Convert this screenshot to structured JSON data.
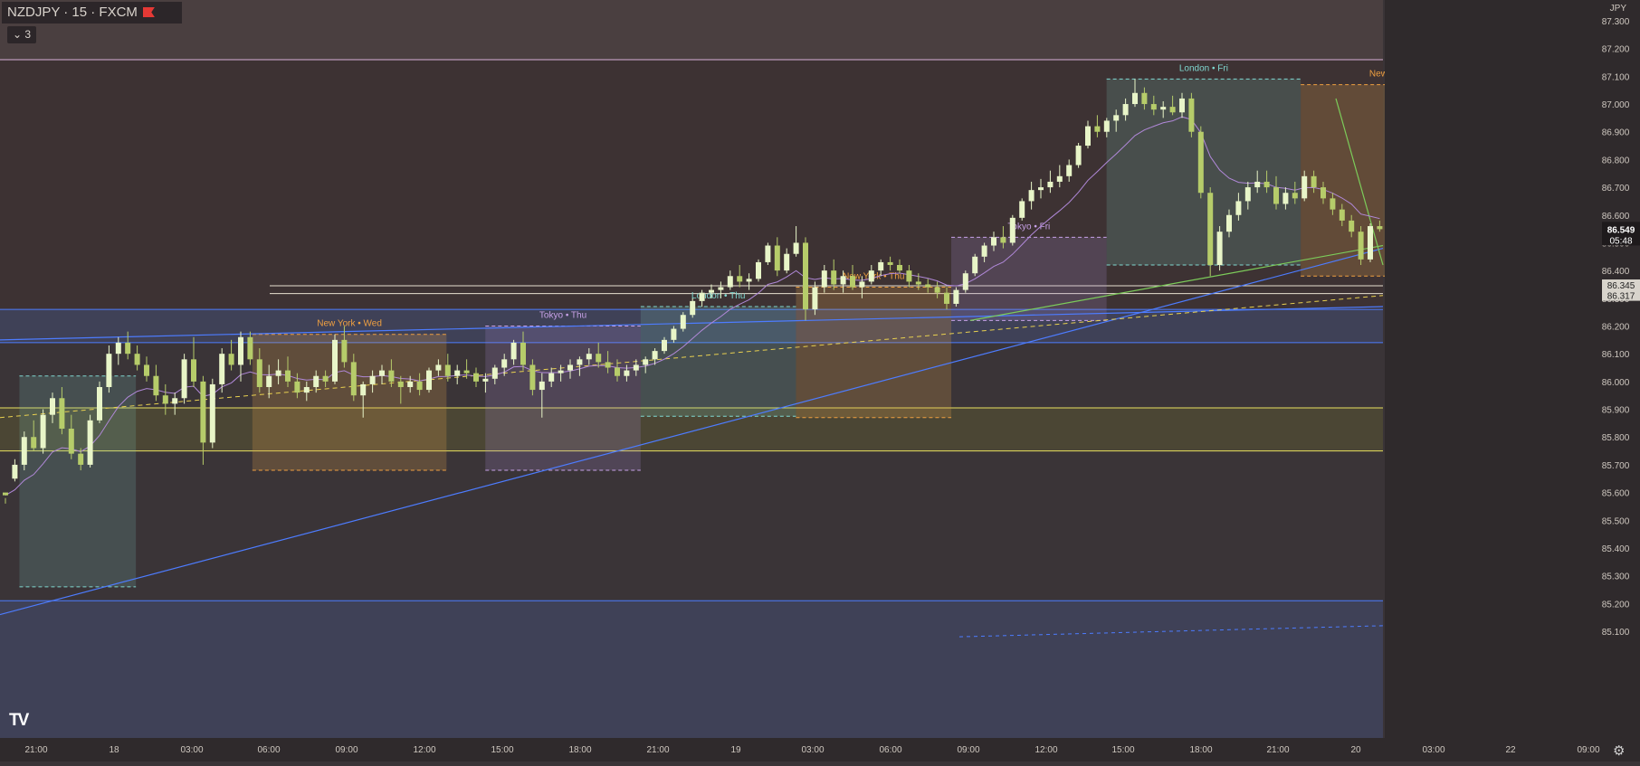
{
  "header": {
    "symbol_title": "NZDJPY · 15 · FXCM",
    "indicator_count": "3",
    "currency": "JPY"
  },
  "colors": {
    "background": "#3a3437",
    "upper_zone": "#4a3f40",
    "middle_zone": "#3d3233",
    "bull": "#e8f5c8",
    "bear": "#b6cc6a",
    "tokyo": "#c8a2e8",
    "london": "#7fd8d0",
    "newyork": "#f0a040",
    "trendline_blue": "#4d7cff",
    "trendline_green": "#7ccc5a",
    "ma_line": "#b088d8",
    "yellow_dashed": "#e8d050"
  },
  "chart_data": {
    "type": "candlestick",
    "symbol": "NZDJPY",
    "interval": "15",
    "source": "FXCM",
    "ylim": [
      85.06,
      87.34
    ],
    "y_ticks": [
      "87.300",
      "87.200",
      "87.100",
      "87.000",
      "86.900",
      "86.800",
      "86.700",
      "86.600",
      "86.500",
      "86.400",
      "86.300",
      "86.200",
      "86.100",
      "86.000",
      "85.900",
      "85.800",
      "85.700",
      "85.600",
      "85.500",
      "85.400",
      "85.300",
      "85.200",
      "85.100"
    ],
    "x_ticks": [
      "21:00",
      "18",
      "03:00",
      "06:00",
      "09:00",
      "12:00",
      "15:00",
      "18:00",
      "21:00",
      "19",
      "03:00",
      "06:00",
      "09:00",
      "12:00",
      "15:00",
      "18:00",
      "21:00",
      "20",
      "03:00",
      "22",
      "09:00"
    ],
    "last_price": "86.549",
    "countdown": "05:48",
    "price_labels": [
      "86.345",
      "86.317"
    ],
    "sessions": [
      {
        "label": "New York • Wed",
        "kind": "newyork",
        "start": 6.5,
        "end": 11.5,
        "high": 86.17,
        "low": 85.68
      },
      {
        "label": "Tokyo • Thu",
        "kind": "tokyo",
        "start": 12.5,
        "end": 16.5,
        "high": 86.2,
        "low": 85.68
      },
      {
        "label": "London • Thu",
        "kind": "london",
        "start": 16.5,
        "end": 20.5,
        "high": 86.27,
        "low": 85.875
      },
      {
        "label": "New York • Thu",
        "kind": "newyork",
        "start": 20.5,
        "end": 24.5,
        "high": 86.34,
        "low": 85.87
      },
      {
        "label": "Tokyo • Fri",
        "kind": "tokyo",
        "start": 24.5,
        "end": 28.5,
        "high": 86.52,
        "low": 86.22
      },
      {
        "label": "London • Fri",
        "kind": "london",
        "start": 28.5,
        "end": 33.5,
        "high": 87.09,
        "low": 86.42
      },
      {
        "label": "New York • Fri",
        "kind": "newyork",
        "start": 33.5,
        "end": 38.5,
        "high": 87.07,
        "low": 86.38
      },
      {
        "label": "",
        "kind": "london",
        "start": 0.5,
        "end": 3.5,
        "high": 86.02,
        "low": 85.26
      }
    ],
    "horizontal_lines": [
      86.345,
      86.317,
      85.905,
      85.75
    ],
    "zones": [
      {
        "top": 87.16,
        "bottom": 87.34
      },
      {
        "top": 86.26,
        "bottom": 86.14
      },
      {
        "top": 85.905,
        "bottom": 85.75
      },
      {
        "top": 85.21,
        "bottom": 85.06
      }
    ],
    "candles": [
      [
        0,
        85.6,
        85.56,
        85.58,
        85.59
      ],
      [
        1,
        85.65,
        85.72,
        85.64,
        85.7
      ],
      [
        2,
        85.7,
        85.82,
        85.68,
        85.8
      ],
      [
        3,
        85.8,
        85.86,
        85.75,
        85.76
      ],
      [
        4,
        85.76,
        85.9,
        85.74,
        85.88
      ],
      [
        5,
        85.88,
        85.96,
        85.85,
        85.94
      ],
      [
        6,
        85.94,
        85.98,
        85.81,
        85.83
      ],
      [
        7,
        85.83,
        85.88,
        85.72,
        85.74
      ],
      [
        8,
        85.74,
        85.76,
        85.68,
        85.7
      ],
      [
        9,
        85.7,
        85.88,
        85.69,
        85.86
      ],
      [
        10,
        85.86,
        86.0,
        85.85,
        85.98
      ],
      [
        11,
        85.98,
        86.13,
        85.96,
        86.1
      ],
      [
        12,
        86.1,
        86.16,
        86.06,
        86.14
      ],
      [
        13,
        86.14,
        86.18,
        86.08,
        86.1
      ],
      [
        14,
        86.1,
        86.13,
        86.04,
        86.06
      ],
      [
        15,
        86.06,
        86.09,
        86.0,
        86.02
      ],
      [
        16,
        86.02,
        86.06,
        85.93,
        85.95
      ],
      [
        17,
        85.95,
        85.99,
        85.88,
        85.92
      ],
      [
        18,
        85.92,
        85.96,
        85.88,
        85.94
      ],
      [
        19,
        85.94,
        86.1,
        85.92,
        86.08
      ],
      [
        20,
        86.08,
        86.16,
        85.98,
        86.0
      ],
      [
        21,
        86.0,
        86.02,
        85.7,
        85.78
      ],
      [
        22,
        85.78,
        86.01,
        85.76,
        85.99
      ],
      [
        23,
        85.99,
        86.12,
        85.96,
        86.1
      ],
      [
        24,
        86.1,
        86.15,
        86.04,
        86.06
      ],
      [
        25,
        86.06,
        86.18,
        86.0,
        86.16
      ],
      [
        26,
        86.16,
        86.18,
        86.06,
        86.08
      ],
      [
        27,
        86.08,
        86.12,
        85.96,
        85.98
      ],
      [
        28,
        85.98,
        86.06,
        85.94,
        86.02
      ],
      [
        29,
        86.02,
        86.08,
        85.99,
        86.04
      ],
      [
        30,
        86.04,
        86.09,
        85.98,
        86.0
      ],
      [
        31,
        86.0,
        86.03,
        85.94,
        85.96
      ],
      [
        32,
        85.96,
        86.0,
        85.93,
        85.98
      ],
      [
        33,
        85.98,
        86.04,
        85.96,
        86.02
      ],
      [
        34,
        86.02,
        86.04,
        85.98,
        86.0
      ],
      [
        35,
        86.0,
        86.17,
        85.99,
        86.15
      ],
      [
        36,
        86.15,
        86.2,
        86.05,
        86.07
      ],
      [
        37,
        86.07,
        86.1,
        85.93,
        85.95
      ],
      [
        38,
        85.95,
        86.0,
        85.87,
        85.99
      ],
      [
        39,
        85.99,
        86.04,
        85.96,
        86.02
      ],
      [
        40,
        86.02,
        86.06,
        85.99,
        86.04
      ],
      [
        41,
        86.04,
        86.08,
        85.98,
        86.0
      ],
      [
        42,
        86.0,
        86.02,
        85.92,
        85.98
      ],
      [
        43,
        85.98,
        86.02,
        85.96,
        86.0
      ],
      [
        44,
        86.0,
        86.03,
        85.95,
        85.97
      ],
      [
        45,
        85.97,
        86.05,
        85.96,
        86.04
      ],
      [
        46,
        86.04,
        86.08,
        86.02,
        86.06
      ],
      [
        47,
        86.06,
        86.1,
        86.0,
        86.02
      ],
      [
        48,
        86.02,
        86.06,
        85.99,
        86.04
      ],
      [
        49,
        86.04,
        86.08,
        86.01,
        86.03
      ],
      [
        50,
        86.03,
        86.05,
        85.98,
        86.0
      ],
      [
        51,
        86.0,
        86.03,
        85.96,
        86.01
      ],
      [
        52,
        86.01,
        86.06,
        85.99,
        86.05
      ],
      [
        53,
        86.05,
        86.1,
        86.02,
        86.08
      ],
      [
        54,
        86.08,
        86.15,
        86.06,
        86.14
      ],
      [
        55,
        86.14,
        86.18,
        86.04,
        86.06
      ],
      [
        56,
        86.06,
        86.08,
        85.95,
        85.97
      ],
      [
        57,
        85.97,
        86.03,
        85.87,
        86.0
      ],
      [
        58,
        86.0,
        86.05,
        85.98,
        86.03
      ],
      [
        59,
        86.03,
        86.06,
        86.0,
        86.04
      ],
      [
        60,
        86.04,
        86.08,
        86.01,
        86.06
      ],
      [
        61,
        86.06,
        86.09,
        86.02,
        86.08
      ],
      [
        62,
        86.08,
        86.12,
        86.06,
        86.1
      ],
      [
        63,
        86.1,
        86.14,
        86.05,
        86.07
      ],
      [
        64,
        86.07,
        86.11,
        86.03,
        86.05
      ],
      [
        65,
        86.05,
        86.08,
        86.0,
        86.02
      ],
      [
        66,
        86.02,
        86.06,
        86.0,
        86.04
      ],
      [
        67,
        86.04,
        86.08,
        86.02,
        86.06
      ],
      [
        68,
        86.06,
        86.09,
        86.03,
        86.08
      ],
      [
        69,
        86.08,
        86.12,
        86.06,
        86.11
      ],
      [
        70,
        86.11,
        86.16,
        86.1,
        86.15
      ],
      [
        71,
        86.15,
        86.2,
        86.14,
        86.19
      ],
      [
        72,
        86.19,
        86.25,
        86.18,
        86.24
      ],
      [
        73,
        86.24,
        86.3,
        86.23,
        86.29
      ],
      [
        74,
        86.29,
        86.33,
        86.27,
        86.32
      ],
      [
        75,
        86.32,
        86.35,
        86.3,
        86.33
      ],
      [
        76,
        86.33,
        86.36,
        86.3,
        86.34
      ],
      [
        77,
        86.34,
        86.4,
        86.33,
        86.38
      ],
      [
        78,
        86.38,
        86.42,
        86.34,
        86.36
      ],
      [
        79,
        86.36,
        86.39,
        86.33,
        86.37
      ],
      [
        80,
        86.37,
        86.44,
        86.36,
        86.43
      ],
      [
        81,
        86.43,
        86.5,
        86.42,
        86.49
      ],
      [
        82,
        86.49,
        86.52,
        86.38,
        86.4
      ],
      [
        83,
        86.4,
        86.48,
        86.39,
        86.46
      ],
      [
        84,
        86.46,
        86.56,
        86.45,
        86.5
      ],
      [
        85,
        86.5,
        86.52,
        86.22,
        86.26
      ],
      [
        86,
        86.26,
        86.36,
        86.24,
        86.34
      ],
      [
        87,
        86.34,
        86.42,
        86.32,
        86.4
      ],
      [
        88,
        86.4,
        86.44,
        86.33,
        86.35
      ],
      [
        89,
        86.35,
        86.4,
        86.32,
        86.38
      ],
      [
        90,
        86.38,
        86.42,
        86.33,
        86.34
      ],
      [
        91,
        86.34,
        86.38,
        86.3,
        86.36
      ],
      [
        92,
        86.36,
        86.42,
        86.35,
        86.4
      ],
      [
        93,
        86.4,
        86.44,
        86.38,
        86.43
      ],
      [
        94,
        86.43,
        86.45,
        86.4,
        86.42
      ],
      [
        95,
        86.42,
        86.44,
        86.39,
        86.4
      ],
      [
        96,
        86.4,
        86.42,
        86.34,
        86.36
      ],
      [
        97,
        86.36,
        86.39,
        86.33,
        86.35
      ],
      [
        98,
        86.35,
        86.37,
        86.32,
        86.34
      ],
      [
        99,
        86.34,
        86.36,
        86.3,
        86.32
      ],
      [
        100,
        86.32,
        86.34,
        86.26,
        86.28
      ],
      [
        101,
        86.28,
        86.34,
        86.27,
        86.33
      ],
      [
        102,
        86.33,
        86.4,
        86.32,
        86.39
      ],
      [
        103,
        86.39,
        86.46,
        86.38,
        86.45
      ],
      [
        104,
        86.45,
        86.5,
        86.43,
        86.49
      ],
      [
        105,
        86.49,
        86.54,
        86.47,
        86.52
      ],
      [
        106,
        86.52,
        86.56,
        86.48,
        86.5
      ],
      [
        107,
        86.5,
        86.6,
        86.49,
        86.59
      ],
      [
        108,
        86.59,
        86.66,
        86.58,
        86.65
      ],
      [
        109,
        86.65,
        86.72,
        86.62,
        86.69
      ],
      [
        110,
        86.69,
        86.73,
        86.66,
        86.7
      ],
      [
        111,
        86.7,
        86.76,
        86.68,
        86.72
      ],
      [
        112,
        86.72,
        86.78,
        86.7,
        86.74
      ],
      [
        113,
        86.74,
        86.8,
        86.72,
        86.78
      ],
      [
        114,
        86.78,
        86.86,
        86.77,
        86.85
      ],
      [
        115,
        86.85,
        86.94,
        86.84,
        86.92
      ],
      [
        116,
        86.92,
        86.96,
        86.88,
        86.9
      ],
      [
        117,
        86.9,
        86.95,
        86.88,
        86.94
      ],
      [
        118,
        86.94,
        86.98,
        86.9,
        86.96
      ],
      [
        119,
        86.96,
        87.02,
        86.94,
        87.0
      ],
      [
        120,
        87.0,
        87.09,
        86.99,
        87.04
      ],
      [
        121,
        87.04,
        87.06,
        86.98,
        87.0
      ],
      [
        122,
        87.0,
        87.03,
        86.96,
        86.98
      ],
      [
        123,
        86.98,
        87.01,
        86.95,
        86.99
      ],
      [
        124,
        86.99,
        87.03,
        86.96,
        86.97
      ],
      [
        125,
        86.97,
        87.04,
        86.95,
        87.02
      ],
      [
        126,
        87.02,
        87.04,
        86.88,
        86.9
      ],
      [
        127,
        86.9,
        86.92,
        86.66,
        86.68
      ],
      [
        128,
        86.68,
        86.7,
        86.38,
        86.42
      ],
      [
        129,
        86.42,
        86.56,
        86.4,
        86.54
      ],
      [
        130,
        86.54,
        86.62,
        86.52,
        86.6
      ],
      [
        131,
        86.6,
        86.68,
        86.58,
        86.65
      ],
      [
        132,
        86.65,
        86.72,
        86.62,
        86.7
      ],
      [
        133,
        86.7,
        86.76,
        86.68,
        86.72
      ],
      [
        134,
        86.72,
        86.76,
        86.68,
        86.7
      ],
      [
        135,
        86.7,
        86.74,
        86.62,
        86.64
      ],
      [
        136,
        86.64,
        86.7,
        86.62,
        86.68
      ],
      [
        137,
        86.68,
        86.72,
        86.64,
        86.66
      ],
      [
        138,
        86.66,
        86.76,
        86.65,
        86.74
      ],
      [
        139,
        86.74,
        86.76,
        86.68,
        86.7
      ],
      [
        140,
        86.7,
        86.72,
        86.64,
        86.66
      ],
      [
        141,
        86.66,
        86.68,
        86.6,
        86.62
      ],
      [
        142,
        86.62,
        86.64,
        86.56,
        86.58
      ],
      [
        143,
        86.58,
        86.6,
        86.52,
        86.54
      ],
      [
        144,
        86.54,
        86.56,
        86.42,
        86.44
      ],
      [
        145,
        86.44,
        86.57,
        86.43,
        86.56
      ],
      [
        146,
        86.56,
        86.58,
        86.54,
        86.549
      ]
    ]
  }
}
